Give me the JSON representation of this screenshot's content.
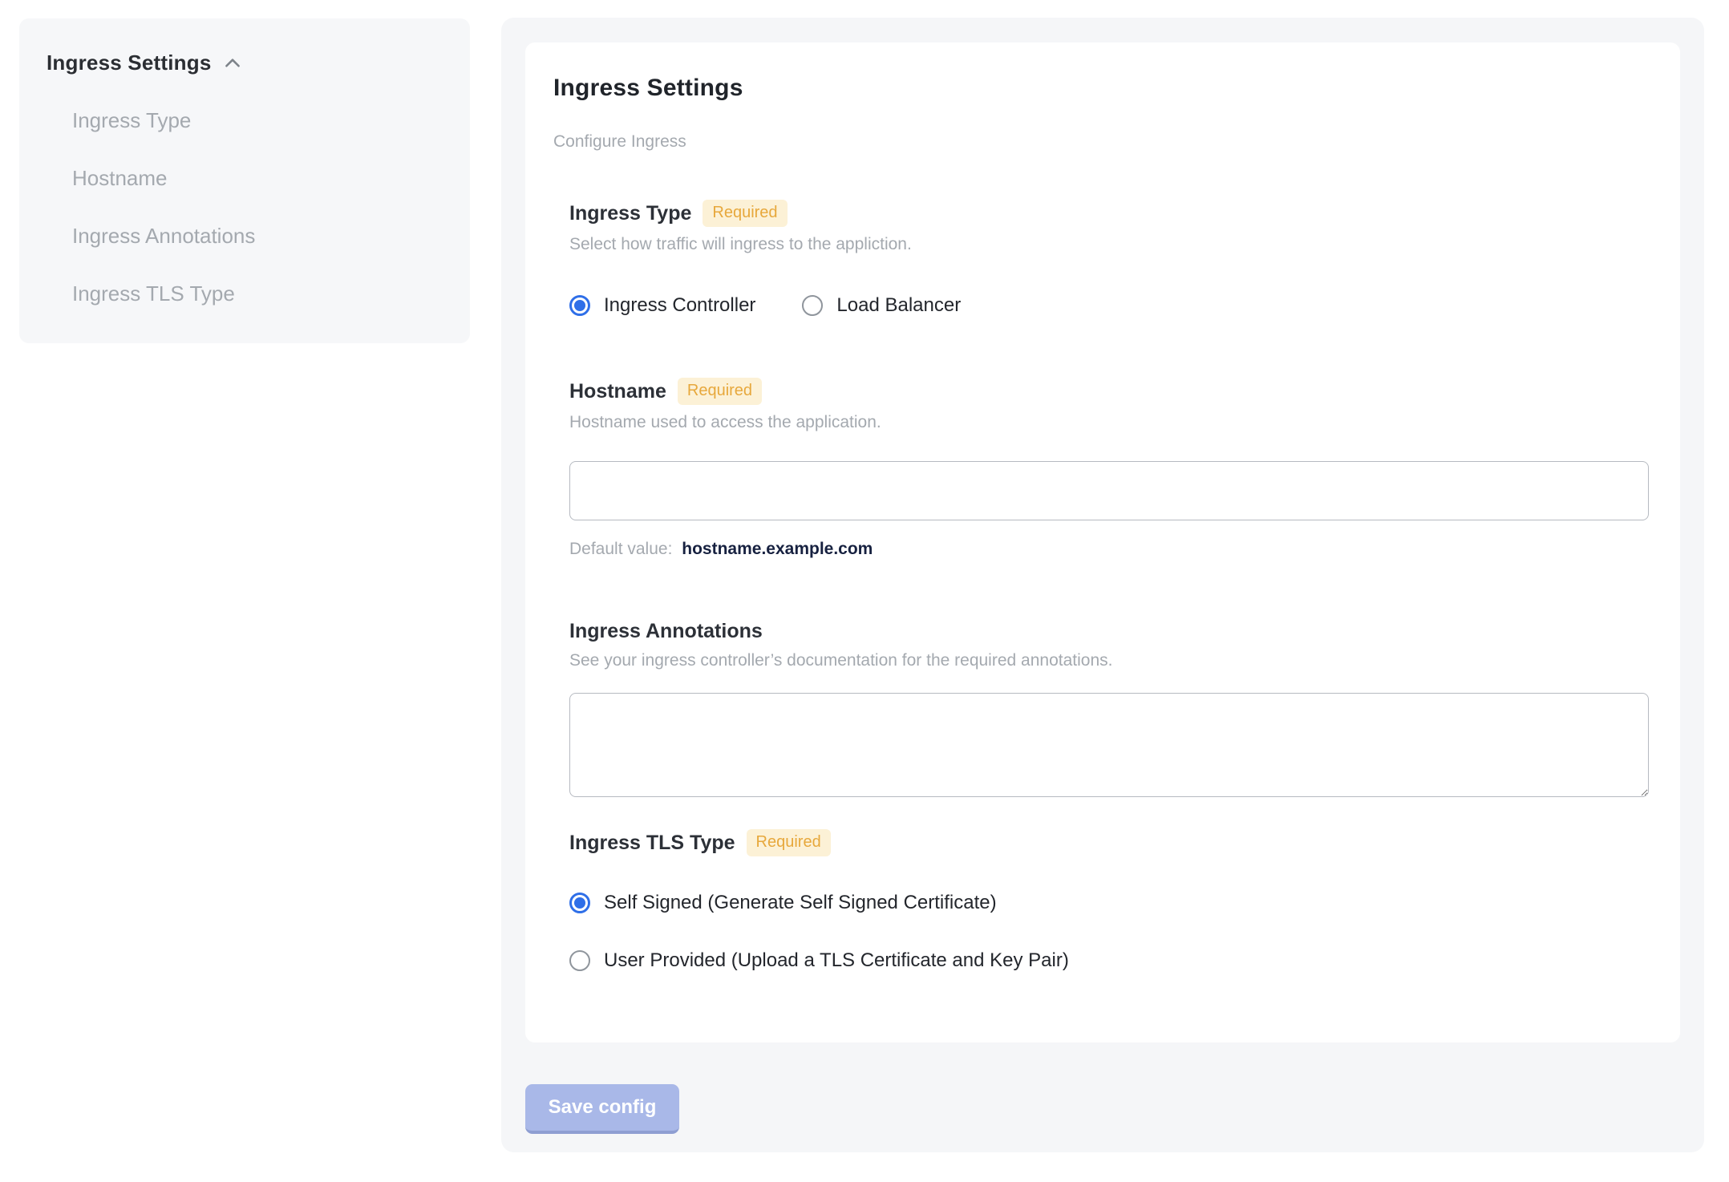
{
  "colors": {
    "accent_blue": "#2F6FE8",
    "panel_gray": "#F5F6F8",
    "badge_bg": "#FCF1D6",
    "badge_text": "#E7A83C",
    "save_button_bg": "#A9B8E8",
    "default_value_text": "#172140",
    "muted_text": "#A4A9AF"
  },
  "sidebar": {
    "header": "Ingress Settings",
    "items": [
      {
        "label": "Ingress Type"
      },
      {
        "label": "Hostname"
      },
      {
        "label": "Ingress Annotations"
      },
      {
        "label": "Ingress TLS Type"
      }
    ]
  },
  "main": {
    "title": "Ingress Settings",
    "subtitle": "Configure Ingress",
    "sections": {
      "ingress_type": {
        "label": "Ingress Type",
        "required_badge": "Required",
        "description": "Select how traffic will ingress to the appliction.",
        "options": [
          {
            "label": "Ingress Controller",
            "selected": true
          },
          {
            "label": "Load Balancer",
            "selected": false
          }
        ]
      },
      "hostname": {
        "label": "Hostname",
        "required_badge": "Required",
        "description": "Hostname used to access the application.",
        "input_value": "",
        "default_value_label": "Default value:",
        "default_value": "hostname.example.com"
      },
      "ingress_annotations": {
        "label": "Ingress Annotations",
        "description": "See your ingress controller’s documentation for the required annotations.",
        "textarea_value": ""
      },
      "ingress_tls_type": {
        "label": "Ingress TLS Type",
        "required_badge": "Required",
        "options": [
          {
            "label": "Self Signed (Generate Self Signed Certificate)",
            "selected": true
          },
          {
            "label": "User Provided (Upload a TLS Certificate and Key Pair)",
            "selected": false
          }
        ]
      }
    },
    "save_button_label": "Save config"
  }
}
